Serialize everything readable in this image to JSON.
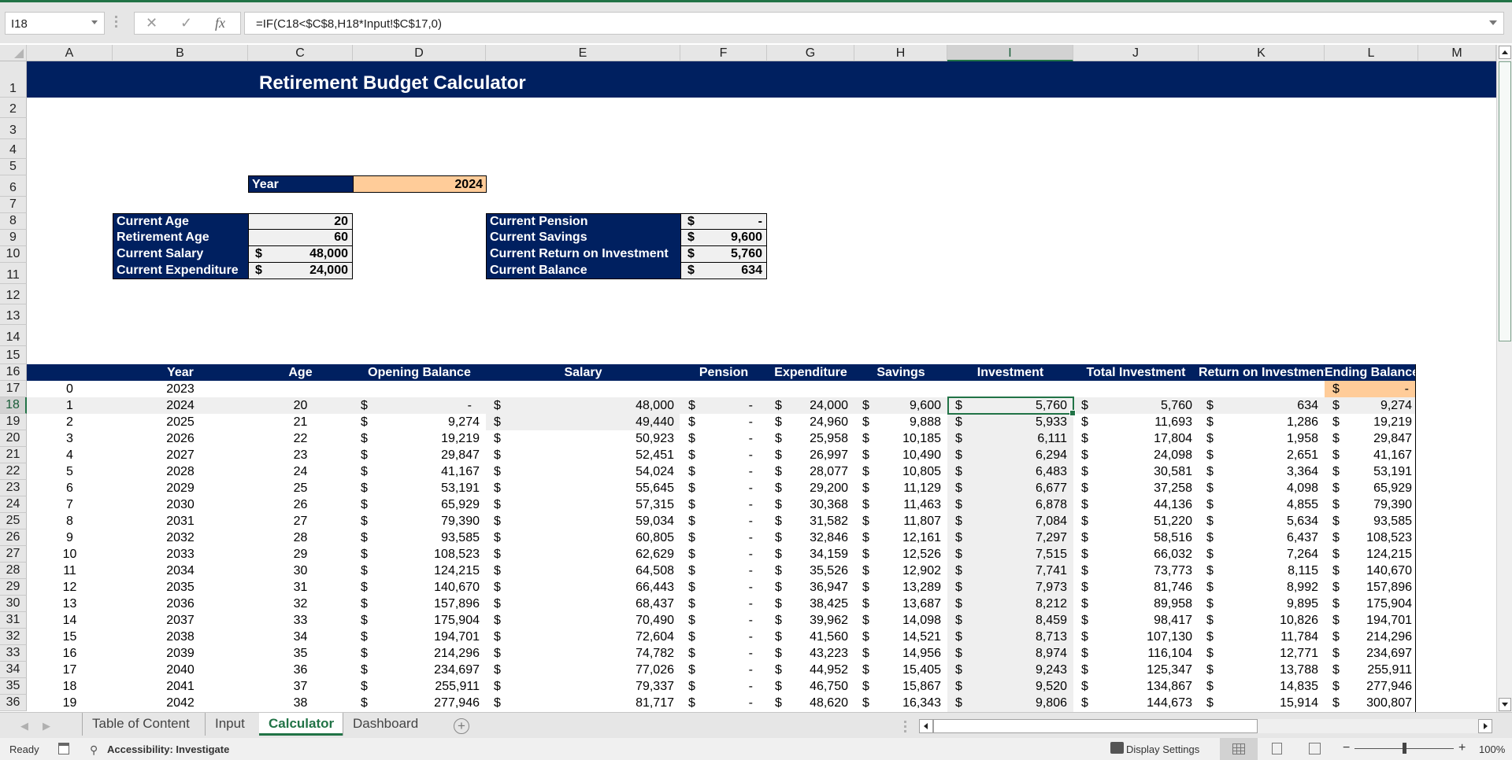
{
  "formula_bar": {
    "name_box": "I18",
    "cancel_icon": "✕",
    "enter_icon": "✓",
    "fx_label": "fx",
    "formula": "=IF(C18<$C$8,H18*Input!$C$17,0)"
  },
  "columns": [
    "A",
    "B",
    "C",
    "D",
    "E",
    "F",
    "G",
    "H",
    "I",
    "J",
    "K",
    "L",
    "M"
  ],
  "selected_column": "I",
  "rows": [
    "1",
    "2",
    "3",
    "4",
    "5",
    "6",
    "7",
    "8",
    "9",
    "10",
    "11",
    "12",
    "13",
    "14",
    "15",
    "16",
    "17",
    "18",
    "19",
    "20",
    "21",
    "22",
    "23",
    "24",
    "25",
    "26",
    "27",
    "28",
    "29",
    "30",
    "31",
    "32",
    "33",
    "34",
    "35",
    "36"
  ],
  "selected_row": "18",
  "sheet": {
    "title": "Retirement Budget Calculator",
    "year_box": {
      "label": "Year",
      "value": "2024"
    },
    "left_box": [
      {
        "label": "Current Age",
        "currency": "",
        "value": "20"
      },
      {
        "label": "Retirement Age",
        "currency": "",
        "value": "60"
      },
      {
        "label": "Current Salary",
        "currency": "$",
        "value": "48,000"
      },
      {
        "label": "Current Expenditure",
        "currency": "$",
        "value": "24,000"
      }
    ],
    "right_box": [
      {
        "label": "Current Pension",
        "currency": "$",
        "value": "-"
      },
      {
        "label": "Current Savings",
        "currency": "$",
        "value": "9,600"
      },
      {
        "label": "Current Return on Investment",
        "currency": "$",
        "value": "5,760"
      },
      {
        "label": "Current Balance",
        "currency": "$",
        "value": "634"
      }
    ],
    "table_headers": [
      "",
      "Year",
      "Age",
      "Opening Balance",
      "Salary",
      "Pension",
      "Expenditure",
      "Savings",
      "Investment",
      "Total Investment",
      "Return on Investment",
      "Ending Balance"
    ],
    "row_zero": {
      "index": "0",
      "year": "2023",
      "ending_currency": "$",
      "ending_balance": "-"
    },
    "table_rows": [
      [
        "1",
        "2024",
        "20",
        "-",
        "48,000",
        "-",
        "24,000",
        "9,600",
        "5,760",
        "5,760",
        "634",
        "9,274"
      ],
      [
        "2",
        "2025",
        "21",
        "9,274",
        "49,440",
        "-",
        "24,960",
        "9,888",
        "5,933",
        "11,693",
        "1,286",
        "19,219"
      ],
      [
        "3",
        "2026",
        "22",
        "19,219",
        "50,923",
        "-",
        "25,958",
        "10,185",
        "6,111",
        "17,804",
        "1,958",
        "29,847"
      ],
      [
        "4",
        "2027",
        "23",
        "29,847",
        "52,451",
        "-",
        "26,997",
        "10,490",
        "6,294",
        "24,098",
        "2,651",
        "41,167"
      ],
      [
        "5",
        "2028",
        "24",
        "41,167",
        "54,024",
        "-",
        "28,077",
        "10,805",
        "6,483",
        "30,581",
        "3,364",
        "53,191"
      ],
      [
        "6",
        "2029",
        "25",
        "53,191",
        "55,645",
        "-",
        "29,200",
        "11,129",
        "6,677",
        "37,258",
        "4,098",
        "65,929"
      ],
      [
        "7",
        "2030",
        "26",
        "65,929",
        "57,315",
        "-",
        "30,368",
        "11,463",
        "6,878",
        "44,136",
        "4,855",
        "79,390"
      ],
      [
        "8",
        "2031",
        "27",
        "79,390",
        "59,034",
        "-",
        "31,582",
        "11,807",
        "7,084",
        "51,220",
        "5,634",
        "93,585"
      ],
      [
        "9",
        "2032",
        "28",
        "93,585",
        "60,805",
        "-",
        "32,846",
        "12,161",
        "7,297",
        "58,516",
        "6,437",
        "108,523"
      ],
      [
        "10",
        "2033",
        "29",
        "108,523",
        "62,629",
        "-",
        "34,159",
        "12,526",
        "7,515",
        "66,032",
        "7,264",
        "124,215"
      ],
      [
        "11",
        "2034",
        "30",
        "124,215",
        "64,508",
        "-",
        "35,526",
        "12,902",
        "7,741",
        "73,773",
        "8,115",
        "140,670"
      ],
      [
        "12",
        "2035",
        "31",
        "140,670",
        "66,443",
        "-",
        "36,947",
        "13,289",
        "7,973",
        "81,746",
        "8,992",
        "157,896"
      ],
      [
        "13",
        "2036",
        "32",
        "157,896",
        "68,437",
        "-",
        "38,425",
        "13,687",
        "8,212",
        "89,958",
        "9,895",
        "175,904"
      ],
      [
        "14",
        "2037",
        "33",
        "175,904",
        "70,490",
        "-",
        "39,962",
        "14,098",
        "8,459",
        "98,417",
        "10,826",
        "194,701"
      ],
      [
        "15",
        "2038",
        "34",
        "194,701",
        "72,604",
        "-",
        "41,560",
        "14,521",
        "8,713",
        "107,130",
        "11,784",
        "214,296"
      ],
      [
        "16",
        "2039",
        "35",
        "214,296",
        "74,782",
        "-",
        "43,223",
        "14,956",
        "8,974",
        "116,104",
        "12,771",
        "234,697"
      ],
      [
        "17",
        "2040",
        "36",
        "234,697",
        "77,026",
        "-",
        "44,952",
        "15,405",
        "9,243",
        "125,347",
        "13,788",
        "255,911"
      ],
      [
        "18",
        "2041",
        "37",
        "255,911",
        "79,337",
        "-",
        "46,750",
        "15,867",
        "9,520",
        "134,867",
        "14,835",
        "277,946"
      ],
      [
        "19",
        "2042",
        "38",
        "277,946",
        "81,717",
        "-",
        "48,620",
        "16,343",
        "9,806",
        "144,673",
        "15,914",
        "300,807"
      ]
    ],
    "currency_symbol": "$"
  },
  "sheet_tabs": {
    "tabs": [
      "Table of Content",
      "Input",
      "Calculator",
      "Dashboard"
    ],
    "active": "Calculator",
    "add_icon": "+"
  },
  "status_bar": {
    "ready": "Ready",
    "accessibility": "Accessibility: Investigate",
    "display_settings": "Display Settings",
    "zoom_minus": "−",
    "zoom_plus": "+",
    "zoom_level": "100%"
  },
  "colors": {
    "excel_green": "#217346",
    "header_navy": "#002060",
    "input_orange": "#ffcc99",
    "cell_gray": "#efefef"
  }
}
